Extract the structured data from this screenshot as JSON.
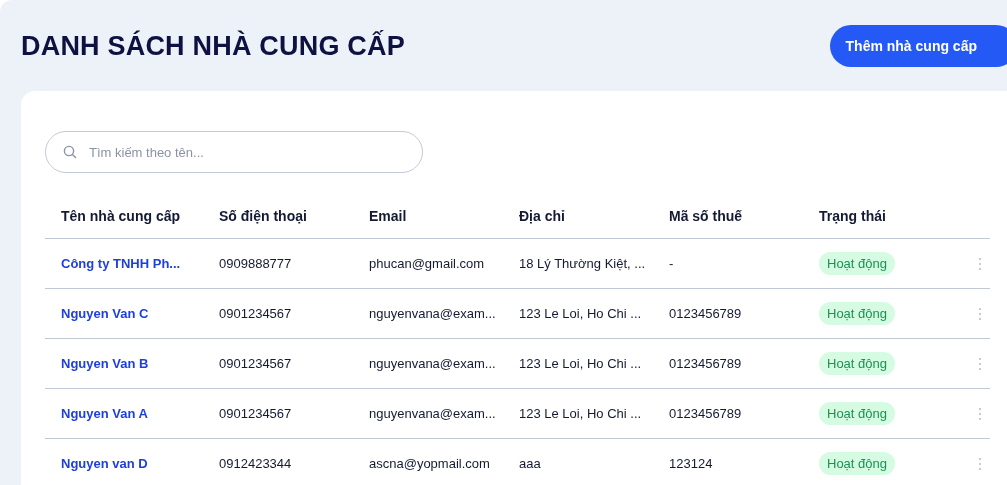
{
  "page": {
    "title": "DANH SÁCH NHÀ CUNG CẤP",
    "add_button": "Thêm nhà cung cấp"
  },
  "search": {
    "placeholder": "Tìm kiếm theo tên..."
  },
  "table": {
    "columns": [
      "Tên nhà cung cấp",
      "Số điện thoại",
      "Email",
      "Địa chỉ",
      "Mã số thuế",
      "Trạng thái"
    ],
    "rows": [
      {
        "name": "Công ty TNHH Ph...",
        "phone": "0909888777",
        "email": "phucan@gmail.com",
        "address": "18 Lý Thường Kiệt, ...",
        "tax_code": "-",
        "status": "Hoạt động"
      },
      {
        "name": "Nguyen Van C",
        "phone": "0901234567",
        "email": "nguyenvana@exam...",
        "address": "123 Le Loi, Ho Chi ...",
        "tax_code": "0123456789",
        "status": "Hoạt động"
      },
      {
        "name": "Nguyen Van B",
        "phone": "0901234567",
        "email": "nguyenvana@exam...",
        "address": "123 Le Loi, Ho Chi ...",
        "tax_code": "0123456789",
        "status": "Hoạt động"
      },
      {
        "name": "Nguyen Van A",
        "phone": "0901234567",
        "email": "nguyenvana@exam...",
        "address": "123 Le Loi, Ho Chi ...",
        "tax_code": "0123456789",
        "status": "Hoạt động"
      },
      {
        "name": "Nguyen van D",
        "phone": "0912423344",
        "email": "ascna@yopmail.com",
        "address": "aaa",
        "tax_code": "123124",
        "status": "Hoạt động"
      }
    ]
  }
}
